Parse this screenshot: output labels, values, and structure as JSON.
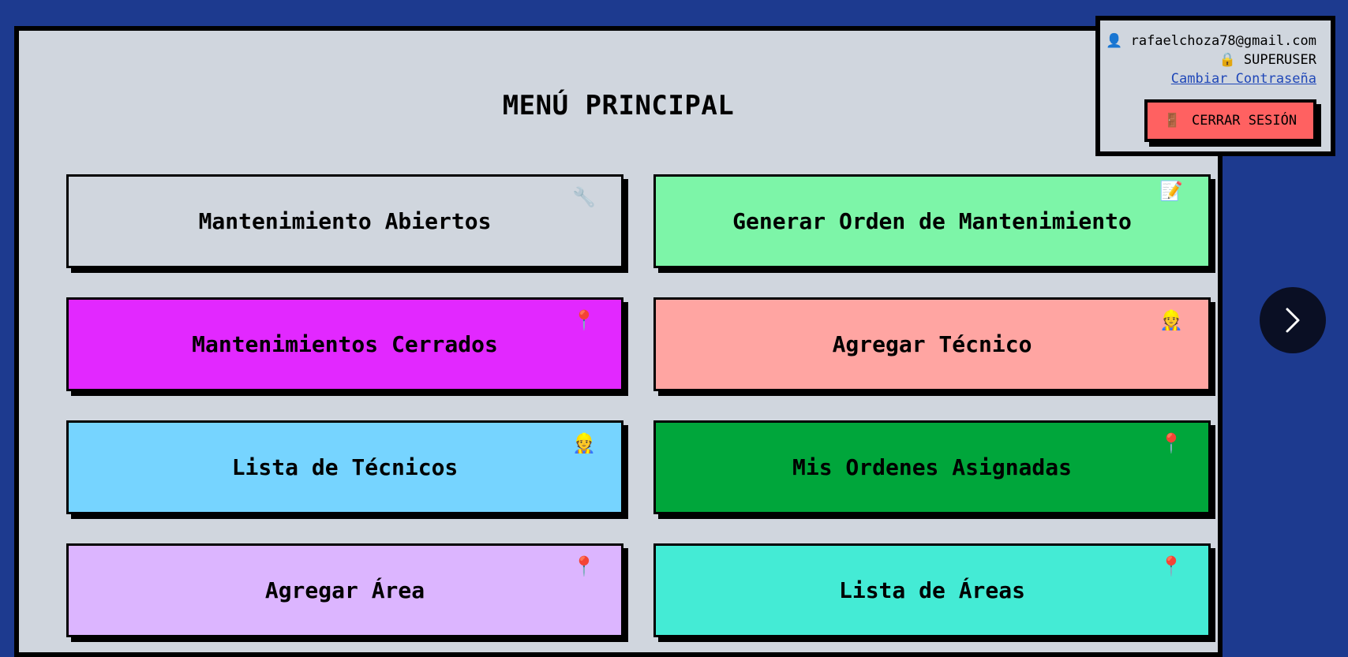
{
  "header": {
    "title": "MENÚ PRINCIPAL"
  },
  "menu": [
    {
      "label": "Mantenimiento Abiertos",
      "icon": "🔧",
      "icon_name": "wrench-icon",
      "color": "#d0d6de"
    },
    {
      "label": "Generar Orden de Mantenimiento",
      "icon": "📝",
      "icon_name": "memo-icon",
      "color": "#7df5a8"
    },
    {
      "label": "Mantenimientos Cerrados",
      "icon": "📍",
      "icon_name": "pin-icon",
      "color": "#e228ff"
    },
    {
      "label": "Agregar Técnico",
      "icon": "👷",
      "icon_name": "worker-icon",
      "color": "#ffa5a2"
    },
    {
      "label": "Lista de Técnicos",
      "icon": "👷",
      "icon_name": "worker-icon",
      "color": "#76d4ff"
    },
    {
      "label": "Mis Ordenes Asignadas",
      "icon": "📍",
      "icon_name": "pin-icon",
      "color": "#00a63b"
    },
    {
      "label": "Agregar Área",
      "icon": "📍",
      "icon_name": "pin-icon",
      "color": "#dcb5ff"
    },
    {
      "label": "Lista de Áreas",
      "icon": "📍",
      "icon_name": "pin-icon",
      "color": "#44ebd5"
    }
  ],
  "user": {
    "email": "rafaelchoza78@gmail.com",
    "email_icon": "👤",
    "role": "SUPERUSER",
    "role_icon": "🔒",
    "change_password": "Cambiar Contraseña",
    "logout": "CERRAR SESIÓN",
    "logout_icon": "🚪"
  },
  "next_icon": "chevron-right-icon",
  "colors": {
    "background": "#1d3a8f",
    "panel": "#d0d6de",
    "logout": "#ff6161",
    "link": "#1f47b8",
    "next_button": "#0a0f24"
  }
}
